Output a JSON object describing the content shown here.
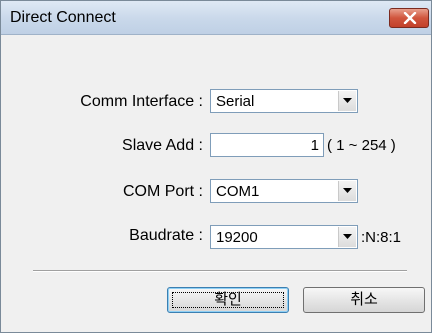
{
  "window": {
    "title": "Direct Connect"
  },
  "form": {
    "comm_interface": {
      "label": "Comm Interface :",
      "value": "Serial"
    },
    "slave_add": {
      "label": "Slave Add :",
      "value": "1",
      "range": "( 1 ~ 254 )"
    },
    "com_port": {
      "label": "COM Port :",
      "value": "COM1"
    },
    "baudrate": {
      "label": "Baudrate :",
      "value": "19200",
      "suffix": ":N:8:1"
    }
  },
  "buttons": {
    "ok_label": "확인",
    "cancel_label": "취소"
  },
  "colors": {
    "close_button": "#d0553d",
    "titlebar": "#c9d8ea",
    "dialog_background": "#f0f0f0"
  },
  "icons": {
    "close": "close-icon",
    "dropdown": "chevron-down-icon"
  }
}
